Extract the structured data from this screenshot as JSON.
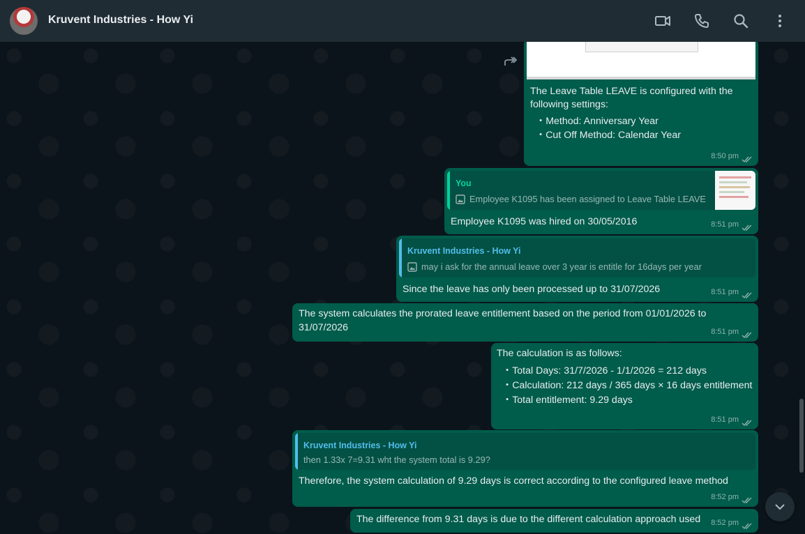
{
  "header": {
    "title": "Kruvent Industries - How Yi",
    "icons": [
      "video-call-icon",
      "voice-call-icon",
      "search-icon",
      "menu-icon"
    ]
  },
  "colors": {
    "bubble_out": "#005c4b",
    "quote_you": "#06cf9c",
    "quote_contact": "#53bdeb",
    "header": "#202c33"
  },
  "messages": {
    "m1": {
      "text1": "The Leave Table LEAVE is configured with the",
      "text2": "following settings:",
      "bullet1": "・Method: Anniversary Year",
      "bullet2": "・Cut Off Method: Calendar Year",
      "time": "8:50 pm"
    },
    "m2": {
      "quote_author": "You",
      "quote_text": "Employee K1095 has been assigned to Leave Table LEAVE",
      "text": "Employee K1095 was hired on 30/05/2016",
      "time": "8:51 pm"
    },
    "m3": {
      "quote_author": "Kruvent Industries - How Yi",
      "quote_text": "may i ask for the annual leave over 3 year is entitle for 16days per year",
      "text": "Since the leave has only been processed up to 31/07/2026",
      "time": "8:51 pm"
    },
    "m4": {
      "text1": "The system calculates the prorated leave entitlement based on the period from 01/01/2026 to",
      "text2": "31/07/2026",
      "time": "8:51 pm"
    },
    "m5": {
      "text": "The calculation is as follows:",
      "bullet1": "・Total Days: 31/7/2026 - 1/1/2026 = 212 days",
      "bullet2": "・Calculation: 212 days / 365 days × 16 days entitlement",
      "bullet3": "・Total entitlement: 9.29 days",
      "time": "8:51 pm"
    },
    "m6": {
      "quote_author": "Kruvent Industries - How Yi",
      "quote_text": "then 1.33x 7=9.31 wht the system total is 9.29?",
      "text": "Therefore, the system calculation of 9.29 days is correct according to the configured leave method",
      "time": "8:52 pm"
    },
    "m7": {
      "text": "The difference from 9.31 days is due to the different calculation approach used",
      "time": "8:52 pm"
    }
  }
}
